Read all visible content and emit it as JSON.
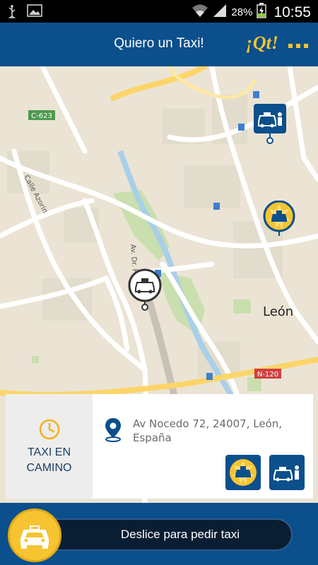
{
  "status_bar": {
    "battery_percent": "28%",
    "time": "10:55",
    "icons": [
      "usb-icon",
      "image-icon",
      "wifi-icon",
      "signal-icon",
      "battery-icon"
    ]
  },
  "header": {
    "title": "Quiero un Taxi!",
    "logo_text": "¡Qt!",
    "menu_icon": "more-dots-icon"
  },
  "map": {
    "road_labels": [
      "C-623",
      "Calle Azorín",
      "Av. Dr. Fl",
      "N-120"
    ],
    "city_label": "León",
    "taxi_count_badge": "1 +"
  },
  "info_card": {
    "status_line1": "TAXI EN",
    "status_line2": "CAMINO",
    "address_line1": "Av Nocedo 72, 24007, León,",
    "address_line2": "España",
    "options": [
      "taxi-option-icon",
      "passenger-taxi-option-icon"
    ]
  },
  "slider": {
    "label": "Deslice para pedir taxi"
  },
  "colors": {
    "brand_blue": "#0b4f8c",
    "brand_yellow": "#f6c431",
    "map_background": "#ebe4d5"
  }
}
